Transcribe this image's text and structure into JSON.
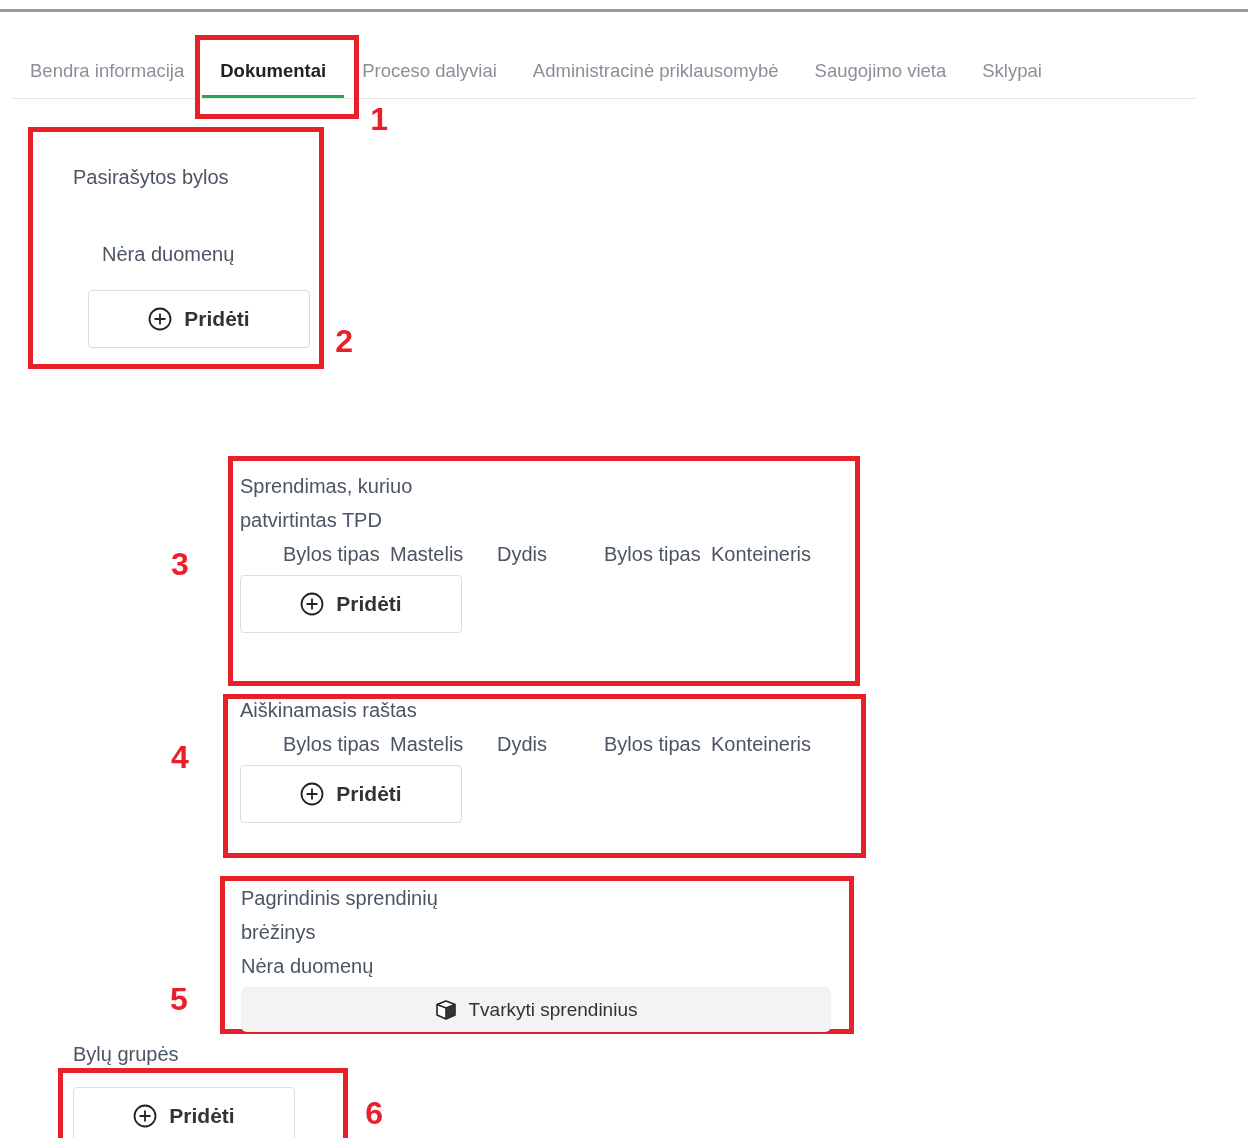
{
  "tabs": [
    {
      "label": "Bendra informacija",
      "selected": false
    },
    {
      "label": "Dokumentai",
      "selected": true,
      "annotation": "1"
    },
    {
      "label": "Proceso dalyviai",
      "selected": false
    },
    {
      "label": "Administracinė priklausomybė",
      "selected": false
    },
    {
      "label": "Saugojimo vieta",
      "selected": false
    },
    {
      "label": "Sklypai",
      "selected": false
    }
  ],
  "sections": [
    {
      "kind": "signed",
      "annotation": "2",
      "title": "Pasirašytos bylos",
      "empty_text": "Nėra duomenų",
      "button": "Pridėti"
    },
    {
      "kind": "table",
      "annotation": "3",
      "title": "Sprendimas, kuriuo patvirtintas TPD",
      "columns": [
        "Bylos tipas",
        "Mastelis",
        "Dydis",
        "Bylos tipas",
        "Konteineris"
      ],
      "button": "Pridėti"
    },
    {
      "kind": "table",
      "annotation": "4",
      "title": "Aiškinamasis raštas",
      "columns": [
        "Bylos tipas",
        "Mastelis",
        "Dydis",
        "Bylos tipas",
        "Konteineris"
      ],
      "button": "Pridėti"
    },
    {
      "kind": "drawing",
      "annotation": "5",
      "title": "Pagrindinis sprendinių brėžinys",
      "empty_text": "Nėra duomenų",
      "button": "Tvarkyti sprendinius"
    },
    {
      "kind": "groups",
      "annotation": "6",
      "title": "Bylų grupės",
      "button": "Pridėti"
    }
  ]
}
